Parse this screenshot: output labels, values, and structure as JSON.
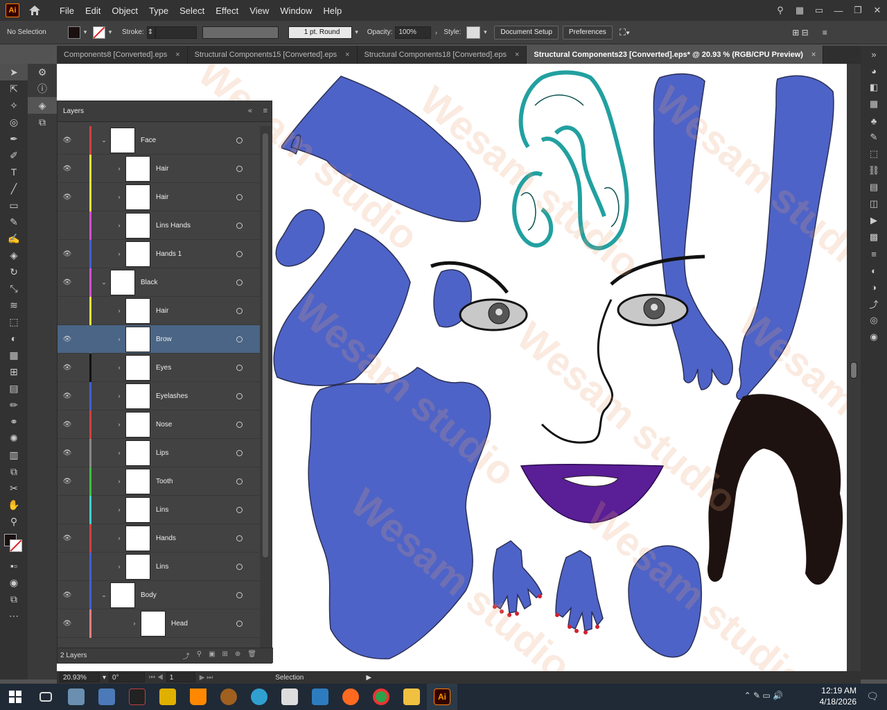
{
  "app": {
    "logo": "Ai",
    "menus": [
      "File",
      "Edit",
      "Object",
      "Type",
      "Select",
      "Effect",
      "View",
      "Window",
      "Help"
    ]
  },
  "control": {
    "selection": "No Selection",
    "stroke_label": "Stroke:",
    "stroke_style": "1 pt. Round",
    "opacity_label": "Opacity:",
    "opacity": "100%",
    "style_label": "Style:",
    "doc_setup": "Document Setup",
    "preferences": "Preferences"
  },
  "tabs": [
    {
      "label": "Components8 [Converted].eps",
      "close": "×"
    },
    {
      "label": "Structural Components15 [Converted].eps",
      "close": "×"
    },
    {
      "label": "Structural Components18 [Converted].eps",
      "close": "×"
    },
    {
      "label": "Structural Components23 [Converted].eps* @ 20.93 % (RGB/CPU Preview)",
      "close": "×"
    }
  ],
  "layers": {
    "title": "Layers",
    "count": "2 Layers",
    "rows": [
      {
        "name": "Face",
        "color": "#d04040",
        "eye": true,
        "level": 0,
        "open": true
      },
      {
        "name": "Hair",
        "color": "#e8e040",
        "eye": true,
        "level": 1
      },
      {
        "name": "Hair",
        "color": "#e8e040",
        "eye": true,
        "level": 1
      },
      {
        "name": "Lins Hands",
        "color": "#d050d0",
        "eye": false,
        "level": 1
      },
      {
        "name": "Hands 1",
        "color": "#4060d0",
        "eye": true,
        "level": 1
      },
      {
        "name": "Black",
        "color": "#d050d0",
        "eye": true,
        "level": 0,
        "open": true
      },
      {
        "name": "Hair",
        "color": "#e8e040",
        "eye": false,
        "level": 1
      },
      {
        "name": "Brow",
        "color": "#4a6585",
        "eye": true,
        "level": 1,
        "selected": true
      },
      {
        "name": "Eyes",
        "color": "#111111",
        "eye": true,
        "level": 1
      },
      {
        "name": "Eyelashes",
        "color": "#4060d0",
        "eye": true,
        "level": 1
      },
      {
        "name": "Nose",
        "color": "#d04040",
        "eye": true,
        "level": 1
      },
      {
        "name": "Lips",
        "color": "#888888",
        "eye": true,
        "level": 1
      },
      {
        "name": "Tooth",
        "color": "#40c040",
        "eye": true,
        "level": 1
      },
      {
        "name": "Lins",
        "color": "#40d0d0",
        "eye": false,
        "level": 1
      },
      {
        "name": "Hands",
        "color": "#d04040",
        "eye": true,
        "level": 1
      },
      {
        "name": "Lins",
        "color": "#4060d0",
        "eye": false,
        "level": 1
      },
      {
        "name": "Body",
        "color": "#4060d0",
        "eye": true,
        "level": 0,
        "open": true
      },
      {
        "name": "Head",
        "color": "#e08080",
        "eye": true,
        "level": 2
      }
    ]
  },
  "status": {
    "zoom": "20.93%",
    "rotate": "0°",
    "artboard": "1",
    "tool": "Selection"
  },
  "watermark": "Wesam studio",
  "taskbar": {
    "time": "12:19 AM",
    "date": "4/18/2026"
  },
  "colors": {
    "skin": "#4e63c7",
    "lips": "#5a1e96",
    "hair_dark": "#1e1210",
    "hair_teal": "#22a0a0"
  }
}
